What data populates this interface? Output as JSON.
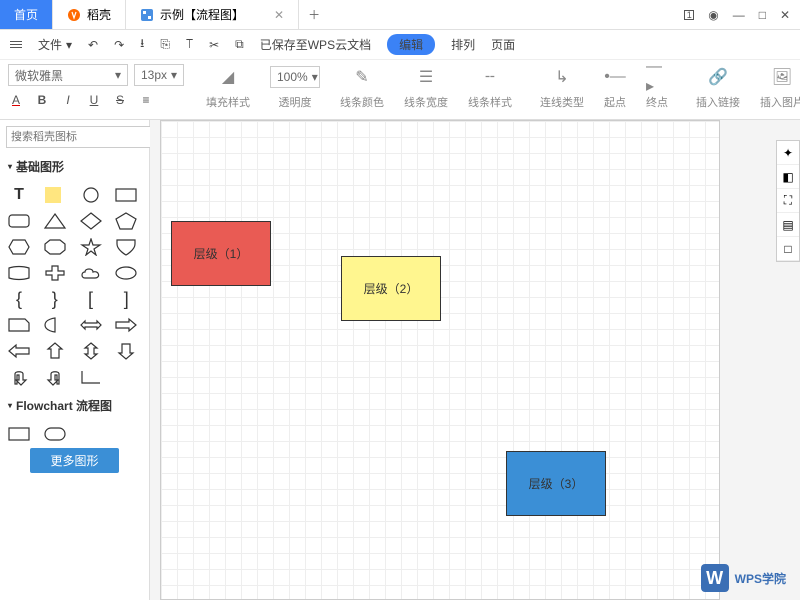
{
  "tabs": {
    "home": "首页",
    "docer": "稻壳",
    "file": "示例【流程图】"
  },
  "menu": {
    "file": "文件",
    "saved": "已保存至WPS云文档",
    "edit": "编辑",
    "arrange": "排列",
    "page": "页面"
  },
  "font": {
    "name": "微软雅黑",
    "size": "13px"
  },
  "opacity": "100%",
  "ribbon": {
    "fill": "填充样式",
    "opacity": "透明度",
    "lineColor": "线条颜色",
    "lineWidth": "线条宽度",
    "lineStyle": "线条样式",
    "connType": "连线类型",
    "start": "起点",
    "end": "终点",
    "link": "插入链接",
    "image": "插入图片"
  },
  "search": {
    "placeholder": "搜索稻壳图标"
  },
  "cats": {
    "basic": "基础图形",
    "flow": "Flowchart 流程图"
  },
  "more": "更多图形",
  "shapes": {
    "s1": "层级（1）",
    "s2": "层级（2）",
    "s3": "层级（3）"
  },
  "wm": "WPS学院",
  "winnum": "1"
}
